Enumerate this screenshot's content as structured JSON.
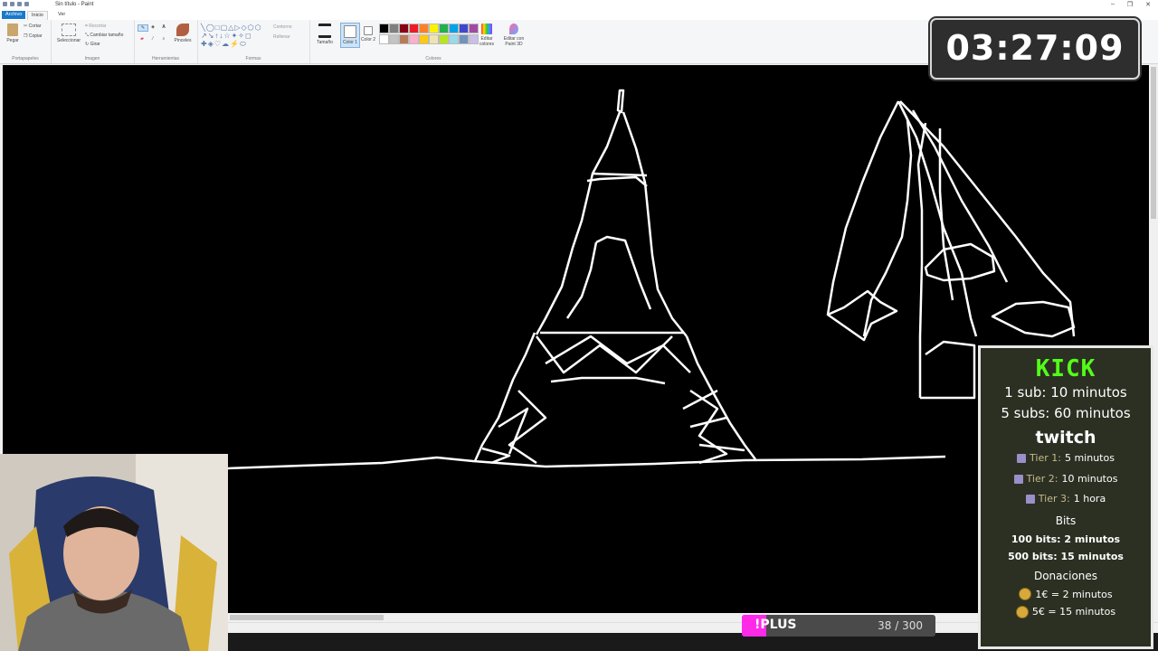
{
  "window": {
    "title": "Sin título - Paint"
  },
  "tabs": [
    {
      "label": "Archivo"
    },
    {
      "label": "Inicio"
    },
    {
      "label": "Ver"
    }
  ],
  "ribbon": {
    "clipboard": {
      "paste": "Pegar",
      "cut": "Cortar",
      "copy": "Copiar",
      "group": "Portapapeles"
    },
    "image": {
      "select": "Seleccionar",
      "crop": "Recortar",
      "resize": "Cambiar tamaño",
      "rotate": "Girar",
      "group": "Imagen"
    },
    "tools": {
      "brushes": "Pinceles",
      "group": "Herramientas"
    },
    "shapes": {
      "outline": "Contorno",
      "fill": "Rellenar",
      "group": "Formas"
    },
    "size": {
      "label": "Tamaño"
    },
    "colors": {
      "color1": "Color 1",
      "color2": "Color 2",
      "edit": "Editar colores",
      "paint3d": "Editar con Paint 3D",
      "group": "Colores"
    },
    "palette": [
      "#000000",
      "#7f7f7f",
      "#880015",
      "#ed1c24",
      "#ff7f27",
      "#fff200",
      "#22b14c",
      "#00a2e8",
      "#3f48cc",
      "#a349a4",
      "#ffffff",
      "#c3c3c3",
      "#b97a57",
      "#ffaec9",
      "#ffc90e",
      "#efe4b0",
      "#b5e61d",
      "#99d9ea",
      "#7092be",
      "#c8bfe7"
    ]
  },
  "timer": {
    "value": "03:27:09"
  },
  "panel": {
    "kick_logo": "KICK",
    "kick_line1": "1 sub: 10 minutos",
    "kick_line2": "5 subs: 60 minutos",
    "twitch_logo": "twitch",
    "tiers": [
      {
        "label": "Tier 1:",
        "value": "5 minutos"
      },
      {
        "label": "Tier 2:",
        "value": "10 minutos"
      },
      {
        "label": "Tier 3:",
        "value": "1 hora"
      }
    ],
    "bits_title": "Bits",
    "bits": [
      "100 bits: 2 minutos",
      "500 bits: 15 minutos"
    ],
    "donations_title": "Donaciones",
    "donations": [
      "1€ = 2 minutos",
      "5€ = 15 minutos"
    ]
  },
  "plus_bar": {
    "label": "!PLUS",
    "current": 38,
    "goal": 300,
    "count_text": "38 / 300",
    "color": "#ff2ae8"
  },
  "colors": {
    "canvas": "#000000",
    "ribbon": "#f5f6f7",
    "accent": "#1979ca"
  }
}
